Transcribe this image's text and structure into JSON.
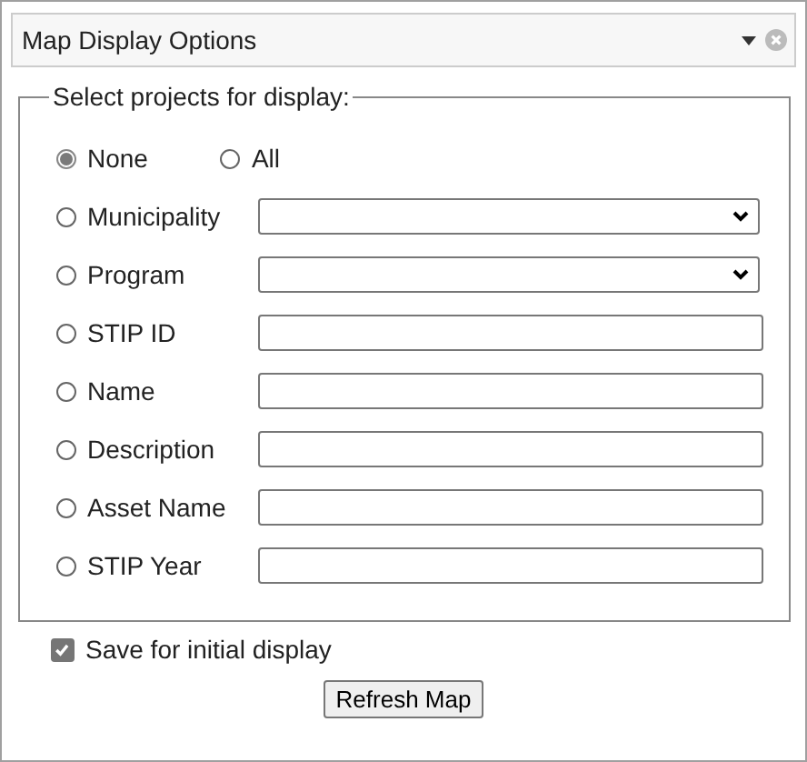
{
  "panel": {
    "title": "Map Display Options"
  },
  "fieldset": {
    "legend": "Select projects for display:",
    "choices": [
      {
        "label": "None",
        "selected": true
      },
      {
        "label": "All",
        "selected": false
      }
    ],
    "filters": [
      {
        "label": "Municipality",
        "kind": "select",
        "selected": false
      },
      {
        "label": "Program",
        "kind": "select",
        "selected": false
      },
      {
        "label": "STIP ID",
        "kind": "text",
        "selected": false
      },
      {
        "label": "Name",
        "kind": "text",
        "selected": false
      },
      {
        "label": "Description",
        "kind": "text",
        "selected": false
      },
      {
        "label": "Asset Name",
        "kind": "text",
        "selected": false
      },
      {
        "label": "STIP Year",
        "kind": "text",
        "selected": false
      }
    ]
  },
  "save": {
    "label": "Save for initial display",
    "checked": true
  },
  "button": "Refresh Map"
}
